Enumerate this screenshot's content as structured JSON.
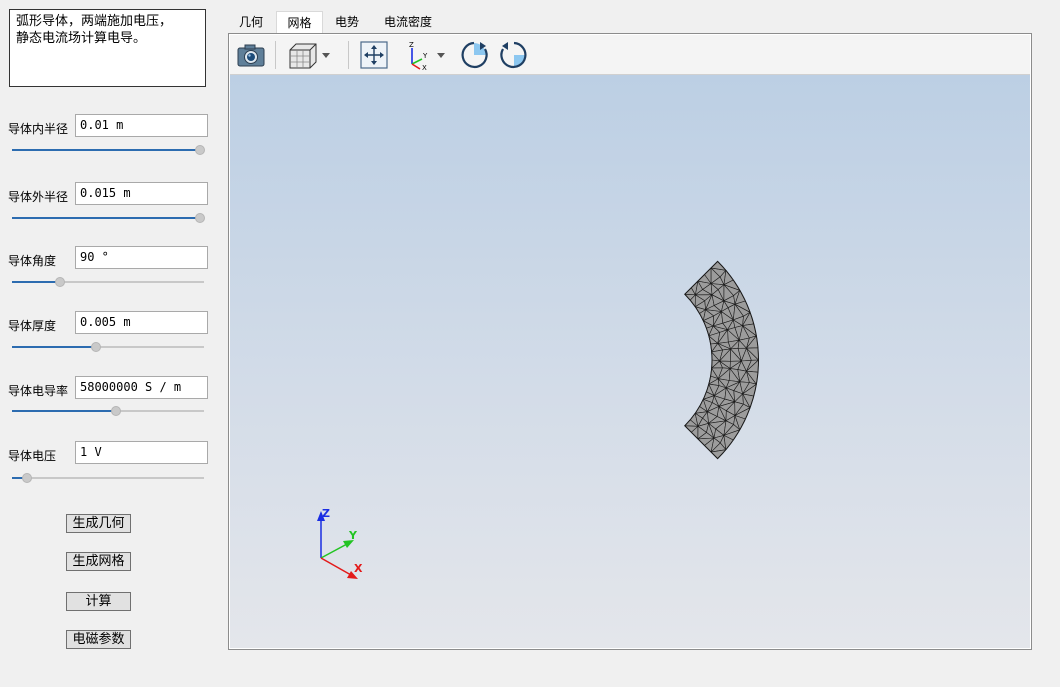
{
  "description": {
    "line1": "弧形导体，两端施加电压，",
    "line2": "静态电流场计算电导。"
  },
  "params": [
    {
      "label": "导体内半径",
      "value": "0.01 m",
      "level": 0.98
    },
    {
      "label": "导体外半径",
      "value": "0.015 m",
      "level": 0.98
    },
    {
      "label": "导体角度",
      "value": "90 °",
      "level": 0.25
    },
    {
      "label": "导体厚度",
      "value": "0.005 m",
      "level": 0.44
    },
    {
      "label": "导体电导率",
      "value": "58000000 S / m",
      "level": 0.54
    },
    {
      "label": "导体电压",
      "value": "1 V",
      "level": 0.08
    }
  ],
  "buttons": {
    "gen_geometry": "生成几何",
    "gen_mesh": "生成网格",
    "compute": "计算",
    "em_params": "电磁参数"
  },
  "tabs": [
    {
      "label": "几何",
      "active": false
    },
    {
      "label": "网格",
      "active": true
    },
    {
      "label": "电势",
      "active": false
    },
    {
      "label": "电流密度",
      "active": false
    }
  ],
  "toolbar": {
    "icons": [
      "camera-icon",
      "cube-view-icon",
      "fit-view-icon",
      "axes-icon",
      "rotate-cw-icon",
      "rotate-ccw-icon"
    ]
  },
  "triad": {
    "x": "X",
    "y": "Y",
    "z": "Z"
  },
  "colors": {
    "slider_fill": "#2c6cb0",
    "mesh_fill": "#9c9c9c",
    "mesh_edge": "#1a1a1a",
    "axis_x": "#e31a1a",
    "axis_y": "#22c422",
    "axis_z": "#1a2ee3"
  },
  "mesh": {
    "inner_radius": 0.01,
    "outer_radius": 0.015,
    "angle_deg": 90
  }
}
